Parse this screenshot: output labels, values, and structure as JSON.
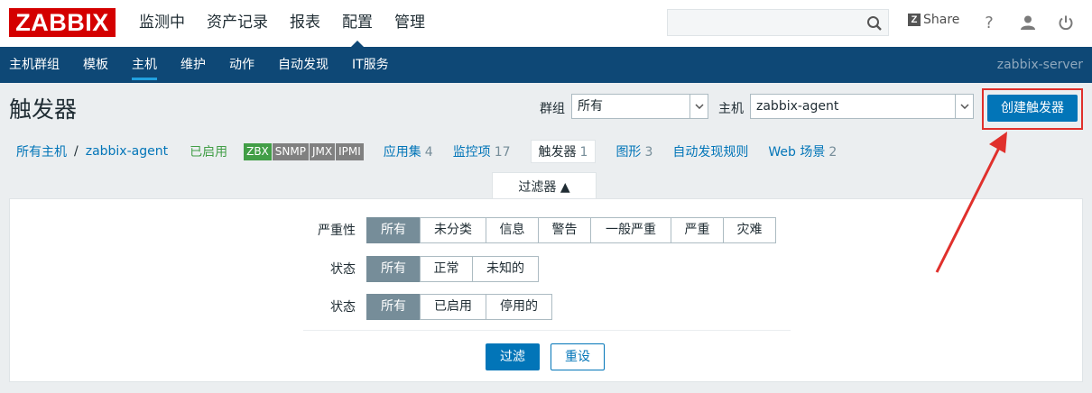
{
  "logo": "ZABBIX",
  "main_nav": [
    "监测中",
    "资产记录",
    "报表",
    "配置",
    "管理"
  ],
  "share_label": "Share",
  "help_label": "?",
  "sub_nav": [
    "主机群组",
    "模板",
    "主机",
    "维护",
    "动作",
    "自动发现",
    "IT服务"
  ],
  "server_name": "zabbix-server",
  "page_title": "触发器",
  "group_label": "群组",
  "group_value": "所有",
  "host_label": "主机",
  "host_value": "zabbix-agent",
  "create_button": "创建触发器",
  "breadcrumb": {
    "all_hosts": "所有主机",
    "separator": "/",
    "host": "zabbix-agent",
    "status": "已启用"
  },
  "availability_tags": [
    "ZBX",
    "SNMP",
    "JMX",
    "IPMI"
  ],
  "host_tabs": [
    {
      "label": "应用集",
      "count": "4"
    },
    {
      "label": "监控项",
      "count": "17"
    },
    {
      "label": "触发器",
      "count": "1"
    },
    {
      "label": "图形",
      "count": "3"
    },
    {
      "label": "自动发现规则",
      "count": ""
    },
    {
      "label": "Web 场景",
      "count": "2"
    }
  ],
  "filter_tab_label": "过滤器 ▲",
  "filter": {
    "severity_label": "严重性",
    "severity_options": [
      "所有",
      "未分类",
      "信息",
      "警告",
      "一般严重",
      "严重",
      "灾难"
    ],
    "state_label": "状态",
    "state_options": [
      "所有",
      "正常",
      "未知的"
    ],
    "status_label": "状态",
    "status_options": [
      "所有",
      "已启用",
      "停用的"
    ],
    "apply_button": "过滤",
    "reset_button": "重设"
  },
  "colors": {
    "brand_red": "#d40000",
    "nav_blue": "#0e4876",
    "link_blue": "#0275b8",
    "enabled_green": "#429e47",
    "selected_grey": "#768d99",
    "annotation_red": "#e0302c"
  }
}
